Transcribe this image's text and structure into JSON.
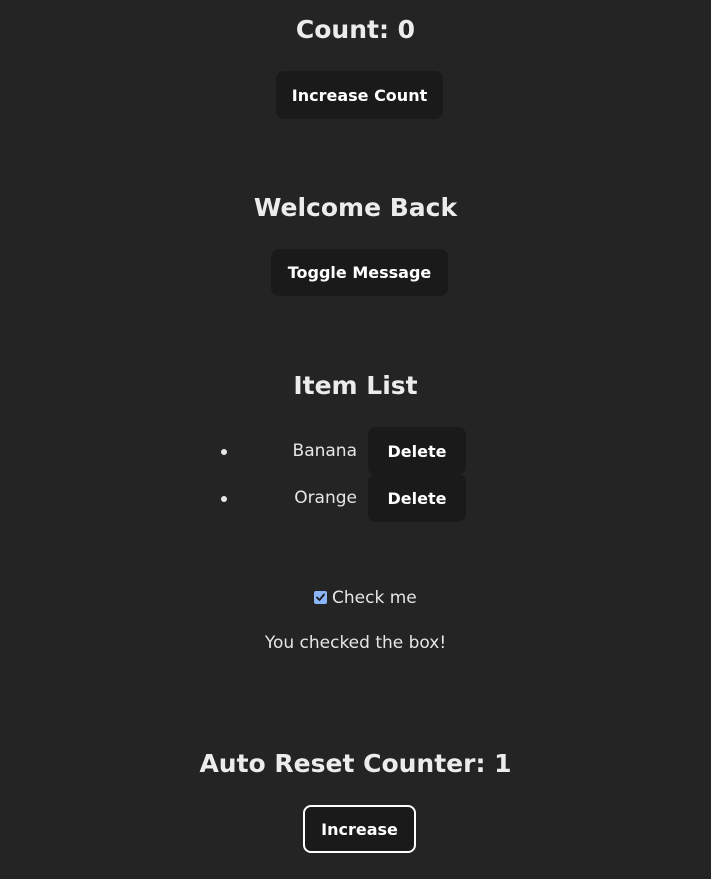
{
  "counter": {
    "title": "Count: 0",
    "button_label": "Increase Count"
  },
  "message": {
    "title": "Welcome Back",
    "button_label": "Toggle Message"
  },
  "item_list": {
    "title": "Item List",
    "items": [
      {
        "label": "Banana",
        "delete_label": "Delete"
      },
      {
        "label": "Orange",
        "delete_label": "Delete"
      }
    ]
  },
  "check": {
    "label": "Check me",
    "checked": true,
    "result_text": "You checked the box!"
  },
  "auto_reset": {
    "title": "Auto Reset Counter: 1",
    "button_label": "Increase"
  },
  "colors": {
    "background": "#242424",
    "button_bg": "#1a1a1a",
    "checkbox_accent": "#8ab4f8"
  }
}
